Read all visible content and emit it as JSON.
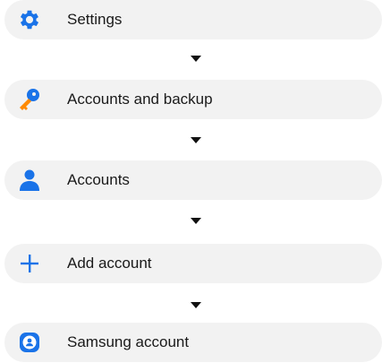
{
  "steps": [
    {
      "icon": "gear-icon",
      "label": "Settings"
    },
    {
      "icon": "key-icon",
      "label": "Accounts and backup"
    },
    {
      "icon": "person-icon",
      "label": "Accounts"
    },
    {
      "icon": "plus-icon",
      "label": "Add account"
    },
    {
      "icon": "account-icon",
      "label": "Samsung account"
    }
  ],
  "colors": {
    "accent": "#1a73e8",
    "row_bg": "#f2f2f2",
    "text": "#1a1a1a"
  }
}
